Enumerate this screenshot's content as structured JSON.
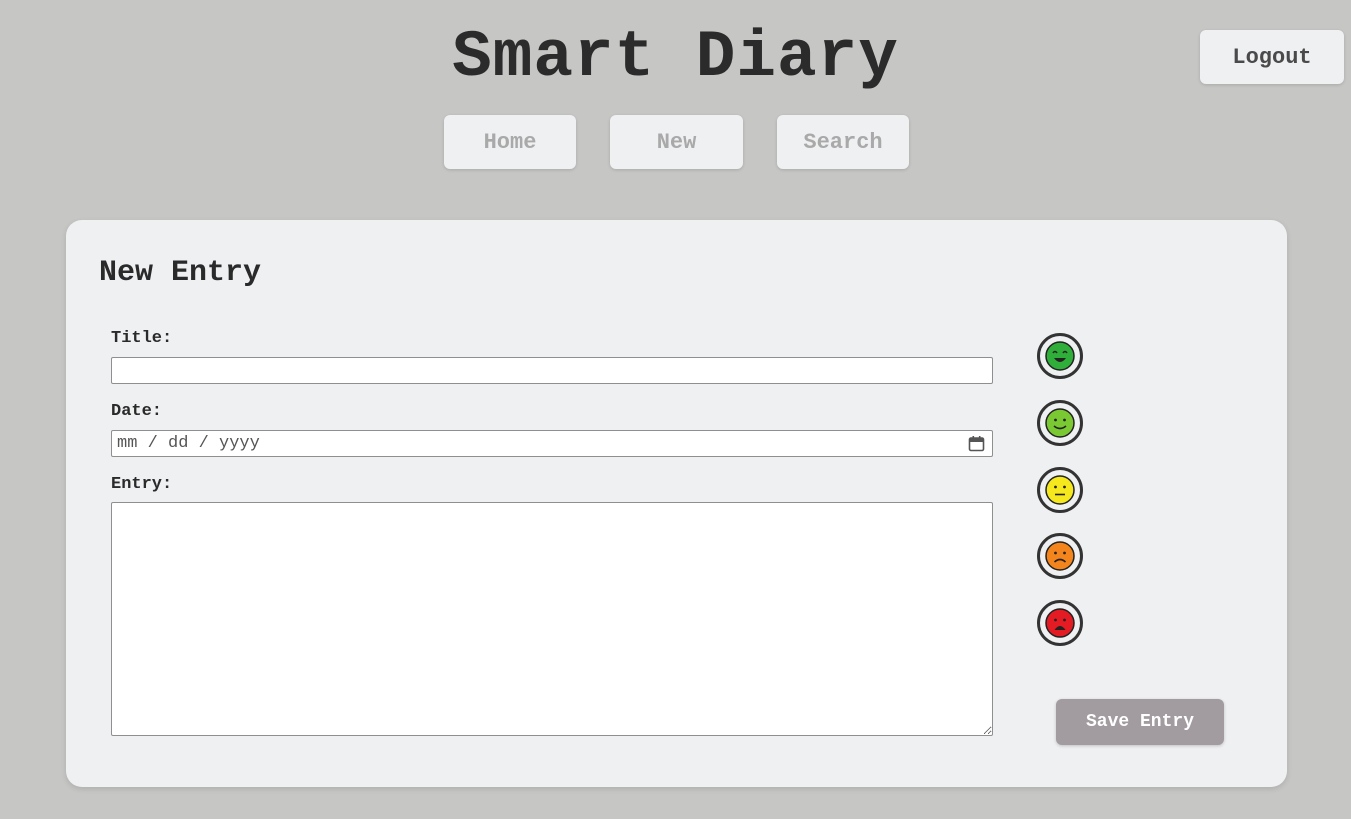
{
  "header": {
    "app_title": "Smart Diary",
    "logout_label": "Logout"
  },
  "nav": {
    "home_label": "Home",
    "new_label": "New",
    "search_label": "Search"
  },
  "form": {
    "heading": "New Entry",
    "title_label": "Title:",
    "title_value": "",
    "date_label": "Date:",
    "date_placeholder": "mm / dd / yyyy",
    "entry_label": "Entry:",
    "entry_value": "",
    "save_label": "Save Entry"
  },
  "moods": [
    {
      "icon": "very-happy-face-icon",
      "color": "#2fae3a"
    },
    {
      "icon": "happy-face-icon",
      "color": "#7ac832"
    },
    {
      "icon": "neutral-face-icon",
      "color": "#f5e81c"
    },
    {
      "icon": "sad-face-icon",
      "color": "#f3851c"
    },
    {
      "icon": "very-sad-face-icon",
      "color": "#e51b24"
    }
  ],
  "colors": {
    "background": "#c6c6c4",
    "card": "#eff0f2",
    "save_button": "#a29b9f",
    "nav_text": "#a9a9a9"
  }
}
